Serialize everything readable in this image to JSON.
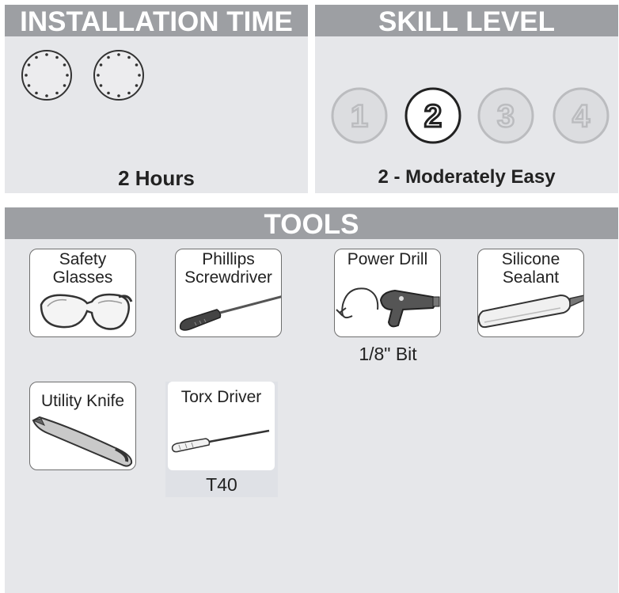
{
  "installation": {
    "header": "INSTALLATION TIME",
    "label": "2 Hours",
    "clock_count": 2,
    "clock_icon": "clock-dial-icon"
  },
  "skill": {
    "header": "SKILL LEVEL",
    "levels": [
      "1",
      "2",
      "3",
      "4"
    ],
    "selected": "2",
    "label": "2 - Moderately Easy"
  },
  "tools": {
    "header": "TOOLS",
    "items": [
      {
        "name_line1": "Safety",
        "name_line2": "Glasses",
        "icon": "safety-glasses-icon"
      },
      {
        "name_line1": "Phillips",
        "name_line2": "Screwdriver",
        "icon": "screwdriver-icon"
      },
      {
        "name_line1": "Power Drill",
        "name_line2": "",
        "icon": "power-drill-icon",
        "note": "1/8\" Bit"
      },
      {
        "name_line1": "Silicone",
        "name_line2": "Sealant",
        "icon": "sealant-tube-icon"
      },
      {
        "name_line1": "Utility Knife",
        "name_line2": "",
        "icon": "utility-knife-icon"
      },
      {
        "name_line1": "Torx Driver",
        "name_line2": "",
        "icon": "torx-driver-icon",
        "note": "T40"
      }
    ]
  },
  "colors": {
    "panel_bg": "#e6e7ea",
    "header_bg": "#9d9fa3",
    "header_text": "#ffffff",
    "level_inactive": "#bbbcbf",
    "level_active_border": "#222222"
  }
}
